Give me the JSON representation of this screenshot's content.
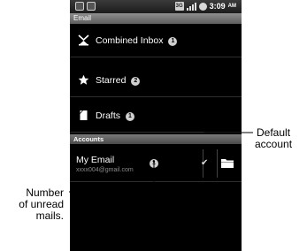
{
  "status_bar": {
    "time": "3:09",
    "ampm": "AM",
    "left_icons": [
      "android-icon",
      "notification-icon"
    ],
    "network_label": "3G"
  },
  "title_bar": {
    "title": "Email"
  },
  "folders": [
    {
      "label": "Combined Inbox",
      "count": "1",
      "icon": "combined-inbox-icon"
    },
    {
      "label": "Starred",
      "count": "2",
      "icon": "star-icon"
    },
    {
      "label": "Drafts",
      "count": "1",
      "icon": "drafts-icon"
    }
  ],
  "accounts_section": {
    "header": "Accounts"
  },
  "account": {
    "name": "My Email",
    "address": "xxxx004@gmail.com",
    "count": "1",
    "is_default": true
  },
  "callouts": {
    "default_account": [
      "Default",
      "account"
    ],
    "unread": [
      "Number",
      "of unread",
      "mails."
    ]
  },
  "colors": {
    "background": "#000000",
    "header_bar": "#7a7a7a",
    "badge": "#d0d0d0"
  }
}
